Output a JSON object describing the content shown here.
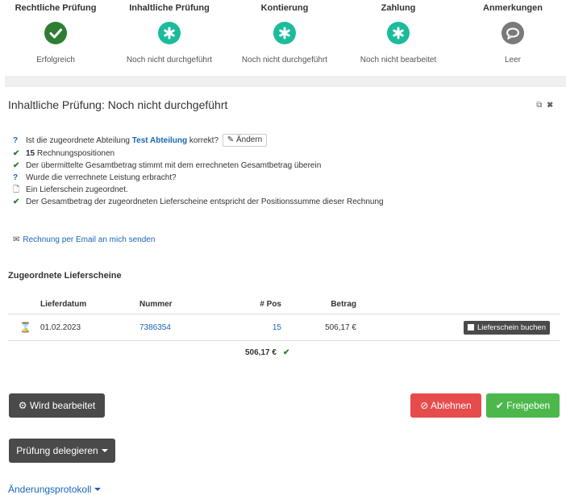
{
  "steps": [
    {
      "title": "Rechtliche Prüfung",
      "status": "Erfolgreich",
      "icon": "check-circle-icon"
    },
    {
      "title": "Inhaltliche Prüfung",
      "status": "Noch nicht durchgeführt",
      "icon": "asterisk-circle-icon"
    },
    {
      "title": "Kontierung",
      "status": "Noch nicht durchgeführt",
      "icon": "asterisk-circle-icon"
    },
    {
      "title": "Zahlung",
      "status": "Noch nicht bearbeitet",
      "icon": "asterisk-circle-icon"
    },
    {
      "title": "Anmerkungen",
      "status": "Leer",
      "icon": "comment-icon"
    }
  ],
  "section": {
    "title": "Inhaltliche Prüfung: Noch nicht durchgeführt"
  },
  "checklist": {
    "dept_prefix": "Ist die zugeordnete Abteilung",
    "dept_name": "Test Abteilung",
    "dept_suffix": "korrekt?",
    "change_label": "Ändern",
    "positions_count": "15",
    "positions_label": "Rechnungspositionen",
    "total_match": "Der übermittelte Gesamtbetrag stimmt mit dem errechneten Gesamtbetrag überein",
    "service_question": "Wurde die verrechnete Leistung erbracht?",
    "delivery_assigned": "Ein Lieferschein zugeordnet.",
    "delivery_sum_match": "Der Gesamtbetrag der zugeordneten Lieferscheine entspricht der Positionssumme dieser Rechnung"
  },
  "email_link": "Rechnung per Email an mich senden",
  "deliveries": {
    "title": "Zugeordnete Lieferscheine",
    "headers": {
      "date": "Lieferdatum",
      "number": "Nummer",
      "pos": "# Pos",
      "amount": "Betrag"
    },
    "row": {
      "date": "01.02.2023",
      "number": "7386354",
      "pos": "15",
      "amount": "506,17 €",
      "book_label": "Lieferschein buchen"
    },
    "total": "506,17 €"
  },
  "buttons": {
    "in_progress": "Wird bearbeitet",
    "reject": "Ablehnen",
    "approve": "Freigeben",
    "delegate": "Prüfung delegieren"
  },
  "protocol_link": "Änderungsprotokoll",
  "colors": {
    "success": "#2e7d32",
    "pending": "#1abc9c",
    "link": "#1a66b5",
    "danger": "#e74c4c",
    "approve": "#4cb84c"
  }
}
